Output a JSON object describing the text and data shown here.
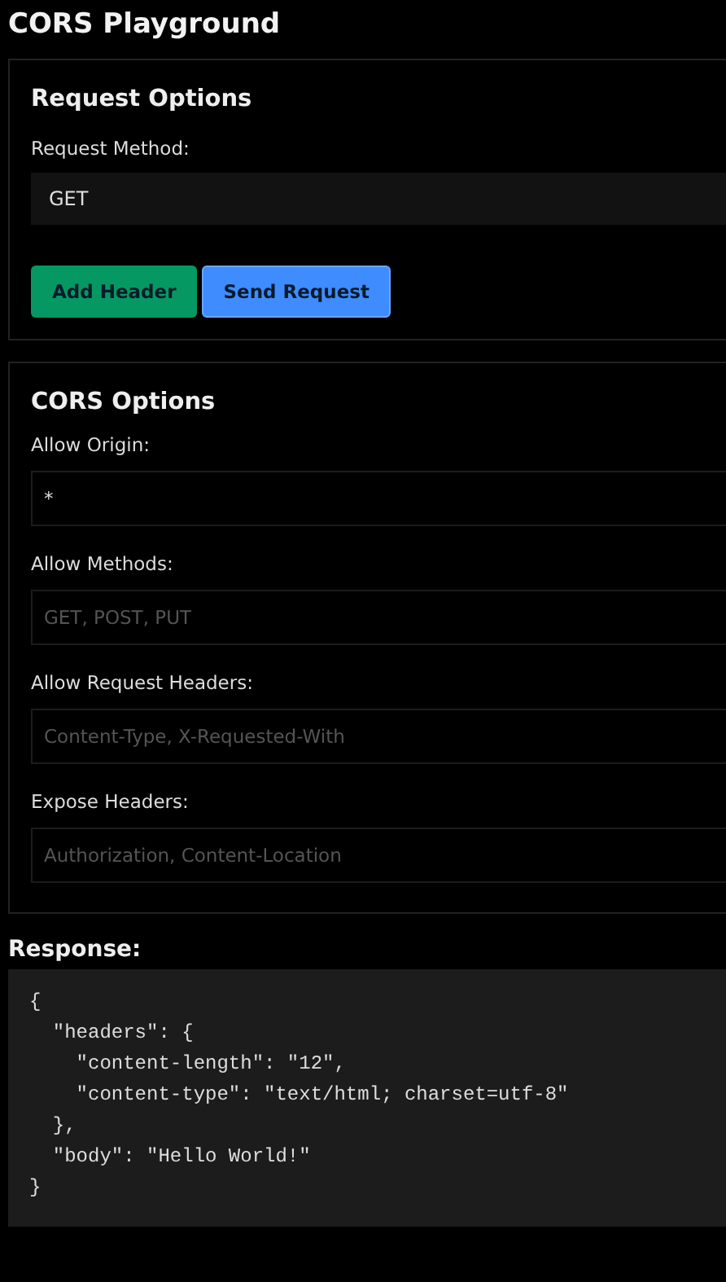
{
  "title": "CORS Playground",
  "request_options": {
    "title": "Request Options",
    "method_label": "Request Method:",
    "method_value": "GET",
    "buttons": [
      {
        "label": "Add Header",
        "kind": "success"
      },
      {
        "label": "Send Request",
        "kind": "primary"
      }
    ]
  },
  "cors_options": {
    "title": "CORS Options",
    "fields": [
      {
        "label": "Allow Origin:",
        "value": "*"
      },
      {
        "label": "Allow Methods:",
        "placeholder": "GET, POST, PUT"
      },
      {
        "label": "Allow Request Headers:",
        "placeholder": "Content-Type, X-Requested-With"
      },
      {
        "label": "Expose Headers:",
        "placeholder": "Authorization, Content-Location"
      }
    ]
  },
  "response": {
    "label": "Response:",
    "lines": [
      "{",
      "  \"headers\": {",
      "    \"content-length\": \"12\",",
      "    \"content-type\": \"text/html; charset=utf-8\"",
      "  },",
      "  \"body\": \"Hello World!\"",
      "}"
    ]
  }
}
